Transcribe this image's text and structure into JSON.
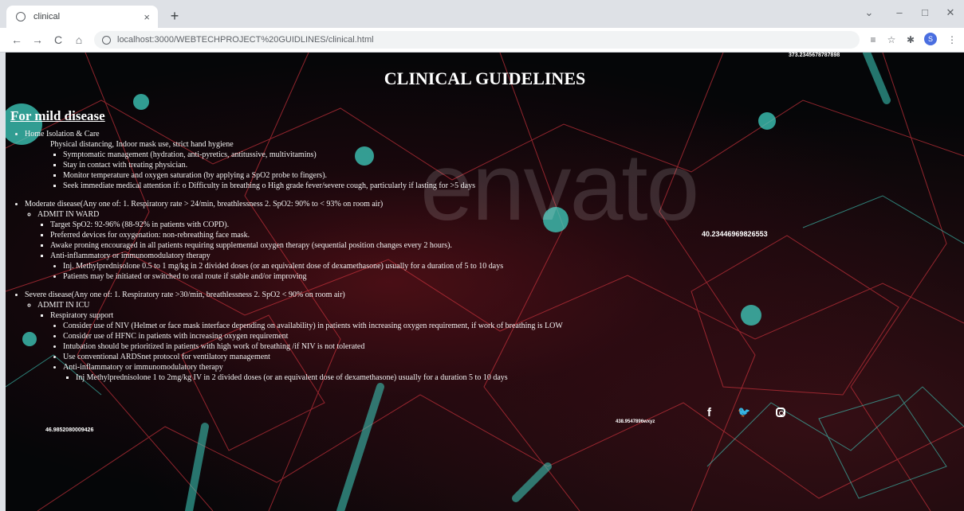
{
  "browser": {
    "tab_title": "clinical",
    "tab_close": "×",
    "new_tab": "+",
    "url": "localhost:3000/WEBTECHPROJECT%20GUIDLINES/clinical.html",
    "profile_initial": "S",
    "window_controls": {
      "minimize": "–",
      "maximize": "□",
      "close": "✕",
      "chevron": "⌄"
    },
    "nav": {
      "back": "←",
      "forward": "→",
      "reload": "C",
      "home": "⌂"
    }
  },
  "page": {
    "title": "CLINICAL GUIDELINES",
    "section_heading": "For mild disease",
    "watermark": "envato",
    "mild": {
      "item": "Home Isolation & Care",
      "plain_line": "Physical distancing, Indoor mask use, strict hand hygiene",
      "sub_items": [
        "Symptomatic management (hydration, anti-pyretics, antitussive, multivitamins)",
        "Stay in contact with treating physician.",
        "Monitor temperature and oxygen saturation (by applying a SpO2 probe to fingers).",
        "Seek immediate medical attention if: o Difficulty in breathing o High grade fever/severe cough, particularly if lasting for >5 days"
      ]
    },
    "moderate": {
      "item": "Moderate disease(Any one of: 1. Respiratory rate > 24/min, breathlessness 2. SpO2: 90% to < 93% on room air)",
      "ward": "ADMIT IN WARD",
      "sub_items": [
        "Target SpO2: 92-96% (88-92% in patients with COPD).",
        "Preferred devices for oxygenation: non-rebreathing face mask.",
        "Awake proning encouraged in all patients requiring supplemental oxygen therapy (sequential position changes every 2 hours).",
        "Anti-inflammatory or immunomodulatory therapy"
      ],
      "therapy_items": [
        "Inj. Methylprednisolone 0.5 to 1 mg/kg in 2 divided doses (or an equivalent dose of dexamethasone) usually for a duration of 5 to 10 days",
        "Patients may be initiated or switched to oral route if stable and/or improving"
      ]
    },
    "severe": {
      "item": "Severe disease(Any one of: 1. Respiratory rate >30/min, breathlessness 2. SpO2 < 90% on room air)",
      "icu": "ADMIT IN ICU",
      "support": "Respiratory support",
      "support_items": [
        "Consider use of NIV (Helmet or face mask interface depending on availability) in patients with increasing oxygen requirement, if work of breathing is LOW",
        "Consider use of HFNC in patients with increasing oxygen requirement",
        "Intubation should be prioritized in patients with high work of breathing /if NIV is not tolerated",
        "Use conventional ARDSnet protocol for ventilatory management",
        "Anti-inflammatory or immunomodulatory therapy"
      ],
      "therapy_item": "Inj Methylprednisolone 1 to 2mg/kg IV in 2 divided doses (or an equivalent dose of dexamethasone) usually for a duration 5 to 10 days"
    },
    "overlay_numbers": {
      "top_right": "373.2345678787898",
      "mid_right": "40.23446969826553",
      "bottom_left": "46.9852080009426",
      "bottom_mid": "438.9547896wxyz"
    },
    "social": {
      "facebook": "f",
      "twitter": "🐦"
    }
  },
  "colors": {
    "background": "#050608",
    "network_red": "#c8323c",
    "network_teal": "#3fd0c0",
    "text": "#f2f2f2"
  }
}
